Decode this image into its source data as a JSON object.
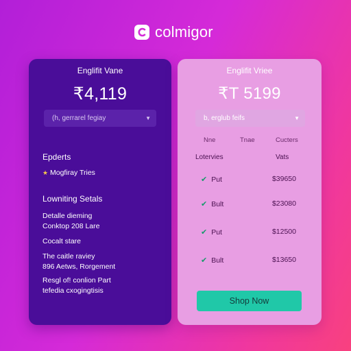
{
  "brand": {
    "name": "colmigor",
    "logo_icon": "c-logo-icon"
  },
  "colors": {
    "left_card": "#4a0d99",
    "right_card": "#e89ee3",
    "button": "#20c8a8",
    "check": "#169a6a"
  },
  "plan_left": {
    "name": "Englifit Vane",
    "price": "₹4,119",
    "select": {
      "value": "(h, gerrarel fegiay"
    },
    "section1_title": "Epderts",
    "feature": "Mogfiray Tries",
    "section2_title": "Lowniting Setals",
    "lines": [
      "Detalle dieming",
      "Conktop 208 Lare",
      "Cocalt stare",
      "The caitle raviey",
      "896 Aetws, Rorgement",
      "Resgl of! conlion Part",
      "tefedia cxogingtisis"
    ]
  },
  "plan_right": {
    "name": "Englifit Vriee",
    "price": "₹T 5199",
    "select": {
      "value": "b, erglub feifs"
    },
    "columns": [
      "Nne",
      "Tnae",
      "Cucters"
    ],
    "row_header_left": "Lotervies",
    "row_header_right": "Vats",
    "rows": [
      {
        "name": "Put",
        "price": "$39650"
      },
      {
        "name": "Bult",
        "price": "$23080"
      },
      {
        "name": "Put",
        "price": "$12500"
      },
      {
        "name": "Bult",
        "price": "$13650"
      }
    ],
    "button": "Shop Now"
  }
}
